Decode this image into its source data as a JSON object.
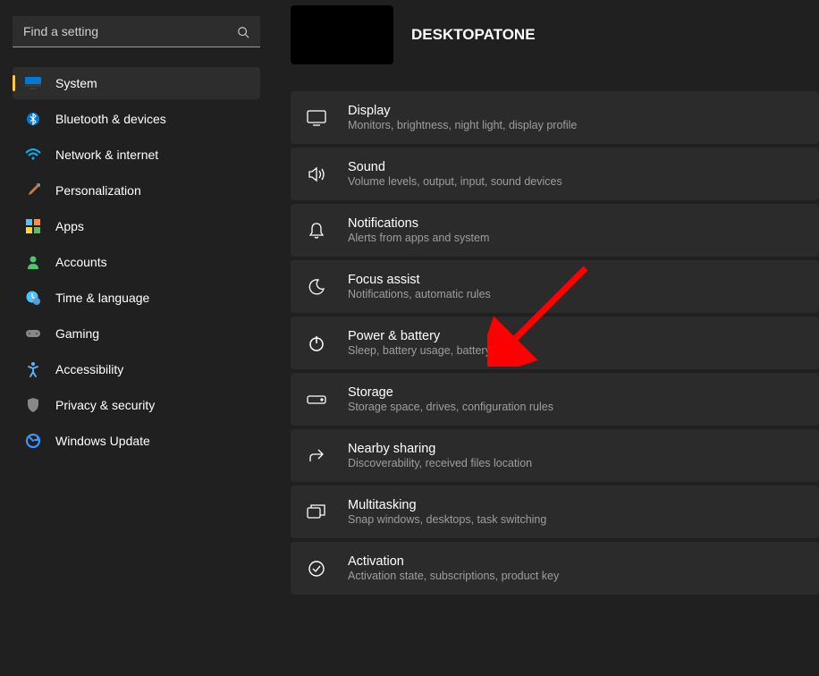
{
  "search": {
    "placeholder": "Find a setting"
  },
  "nav": [
    {
      "key": "system",
      "label": "System",
      "active": true
    },
    {
      "key": "bluetooth",
      "label": "Bluetooth & devices"
    },
    {
      "key": "network",
      "label": "Network & internet"
    },
    {
      "key": "personalization",
      "label": "Personalization"
    },
    {
      "key": "apps",
      "label": "Apps"
    },
    {
      "key": "accounts",
      "label": "Accounts"
    },
    {
      "key": "time",
      "label": "Time & language"
    },
    {
      "key": "gaming",
      "label": "Gaming"
    },
    {
      "key": "accessibility",
      "label": "Accessibility"
    },
    {
      "key": "privacy",
      "label": "Privacy & security"
    },
    {
      "key": "update",
      "label": "Windows Update"
    }
  ],
  "header": {
    "pc_name": "DESKTOPATONE"
  },
  "settings": [
    {
      "key": "display",
      "title": "Display",
      "sub": "Monitors, brightness, night light, display profile"
    },
    {
      "key": "sound",
      "title": "Sound",
      "sub": "Volume levels, output, input, sound devices"
    },
    {
      "key": "notifications",
      "title": "Notifications",
      "sub": "Alerts from apps and system"
    },
    {
      "key": "focus",
      "title": "Focus assist",
      "sub": "Notifications, automatic rules"
    },
    {
      "key": "power",
      "title": "Power & battery",
      "sub": "Sleep, battery usage, battery saver"
    },
    {
      "key": "storage",
      "title": "Storage",
      "sub": "Storage space, drives, configuration rules"
    },
    {
      "key": "nearby",
      "title": "Nearby sharing",
      "sub": "Discoverability, received files location"
    },
    {
      "key": "multitasking",
      "title": "Multitasking",
      "sub": "Snap windows, desktops, task switching"
    },
    {
      "key": "activation",
      "title": "Activation",
      "sub": "Activation state, subscriptions, product key"
    }
  ]
}
